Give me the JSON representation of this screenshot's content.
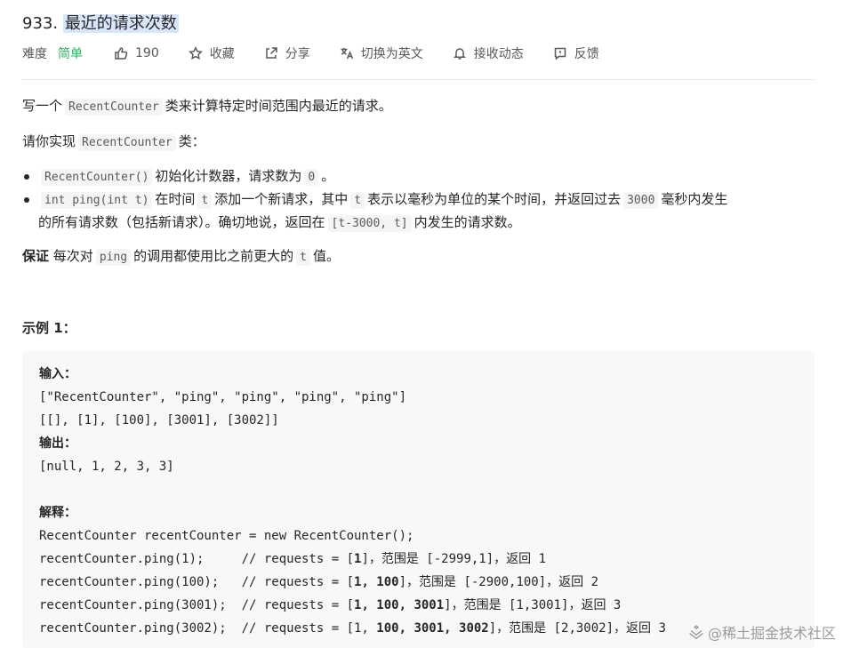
{
  "problem": {
    "number": "933.",
    "title": "最近的请求次数"
  },
  "meta": {
    "difficulty_label": "难度",
    "difficulty_value": "简单",
    "likes": "190",
    "favorite": "收藏",
    "share": "分享",
    "switch_lang": "切换为英文",
    "notifications": "接收动态",
    "feedback": "反馈"
  },
  "description": {
    "line1_pre": "写一个",
    "line1_code": "RecentCounter",
    "line1_post": "类来计算特定时间范围内最近的请求。",
    "line2_pre": "请你实现",
    "line2_code": "RecentCounter",
    "line2_post": "类：",
    "bullet1_code": "RecentCounter()",
    "bullet1_text": "初始化计数器，请求数为",
    "bullet1_code2": "0",
    "bullet1_end": "。",
    "bullet2_code": "int ping(int t)",
    "bullet2_t1": "在时间",
    "bullet2_code_t": "t",
    "bullet2_t2": "添加一个新请求，其中",
    "bullet2_code_t2": "t",
    "bullet2_t3": "表示以毫秒为单位的某个时间，并返回过去",
    "bullet2_code_3000": "3000",
    "bullet2_t4": "毫秒内发生",
    "bullet2_line2_a": "的所有请求数（包括新请求）。确切地说，返回在",
    "bullet2_code_range": "[t-3000, t]",
    "bullet2_line2_b": "内发生的请求数。",
    "guarantee_bold": "保证",
    "guarantee_a": "每次对",
    "guarantee_code": "ping",
    "guarantee_b": "的调用都使用比之前更大的",
    "guarantee_code_t": "t",
    "guarantee_c": "值。"
  },
  "example": {
    "title": "示例 1：",
    "input_label": "输入：",
    "input_line1": "[\"RecentCounter\", \"ping\", \"ping\", \"ping\", \"ping\"]",
    "input_line2": "[[], [1], [100], [3001], [3002]]",
    "output_label": "输出：",
    "output_line": "[null, 1, 2, 3, 3]",
    "explain_label": "解释：",
    "code1": "RecentCounter recentCounter = new RecentCounter();",
    "c2_pre": "recentCounter.ping(1);     // requests = [",
    "c2_bold": "1",
    "c2_post": "]，范围是 [-2999,1]，返回 1",
    "c3_pre": "recentCounter.ping(100);   // requests = [",
    "c3_bold": "1, 100",
    "c3_post": "]，范围是 [-2900,100]，返回 2",
    "c4_pre": "recentCounter.ping(3001);  // requests = [",
    "c4_bold": "1, 100, 3001",
    "c4_post": "]，范围是 [1,3001]，返回 3",
    "c5_pre": "recentCounter.ping(3002);  // requests = [1, ",
    "c5_bold": "100, 3001, 3002",
    "c5_post": "]，范围是 [2,3002]，返回 3"
  },
  "watermark": "@稀土掘金技术社区",
  "icons": [
    "thumbs-up-icon",
    "star-icon",
    "share-icon",
    "translate-icon",
    "bell-icon",
    "feedback-icon"
  ],
  "colors": {
    "easy": "#2db55d",
    "title_highlight": "#d8e6fb",
    "code_bg": "#f7f8fa"
  }
}
